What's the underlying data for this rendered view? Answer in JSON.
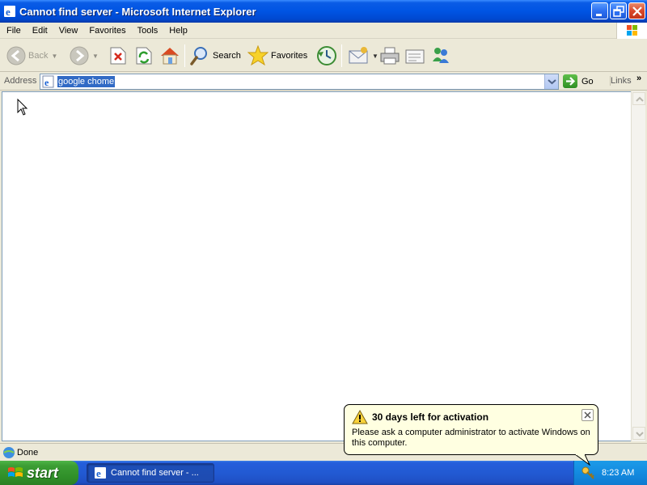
{
  "window": {
    "title": "Cannot find server - Microsoft Internet Explorer"
  },
  "menubar": {
    "items": [
      "File",
      "Edit",
      "View",
      "Favorites",
      "Tools",
      "Help"
    ]
  },
  "toolbar": {
    "back_label": "Back",
    "search_label": "Search",
    "favorites_label": "Favorites",
    "icons": [
      "back-icon",
      "forward-icon",
      "stop-icon",
      "refresh-icon",
      "home-icon",
      "search-icon",
      "favorites-icon",
      "history-icon",
      "mail-icon",
      "print-icon",
      "edit-icon",
      "messenger-icon"
    ]
  },
  "addressbar": {
    "label": "Address",
    "value": "google chome",
    "go_label": "Go",
    "links_label": "Links",
    "links_chevron": "»"
  },
  "statusbar": {
    "text": "Done"
  },
  "taskbar": {
    "start_label": "start",
    "task_label": "Cannot find server - ...",
    "clock": "8:23 AM"
  },
  "balloon": {
    "title": "30 days left for activation",
    "text": "Please ask a computer administrator to activate Windows on this computer."
  },
  "colors": {
    "titlebar": "#0054e3",
    "selection": "#316ac5",
    "taskbar": "#225ad3",
    "start": "#3c9e34",
    "balloon": "#ffffe1"
  }
}
